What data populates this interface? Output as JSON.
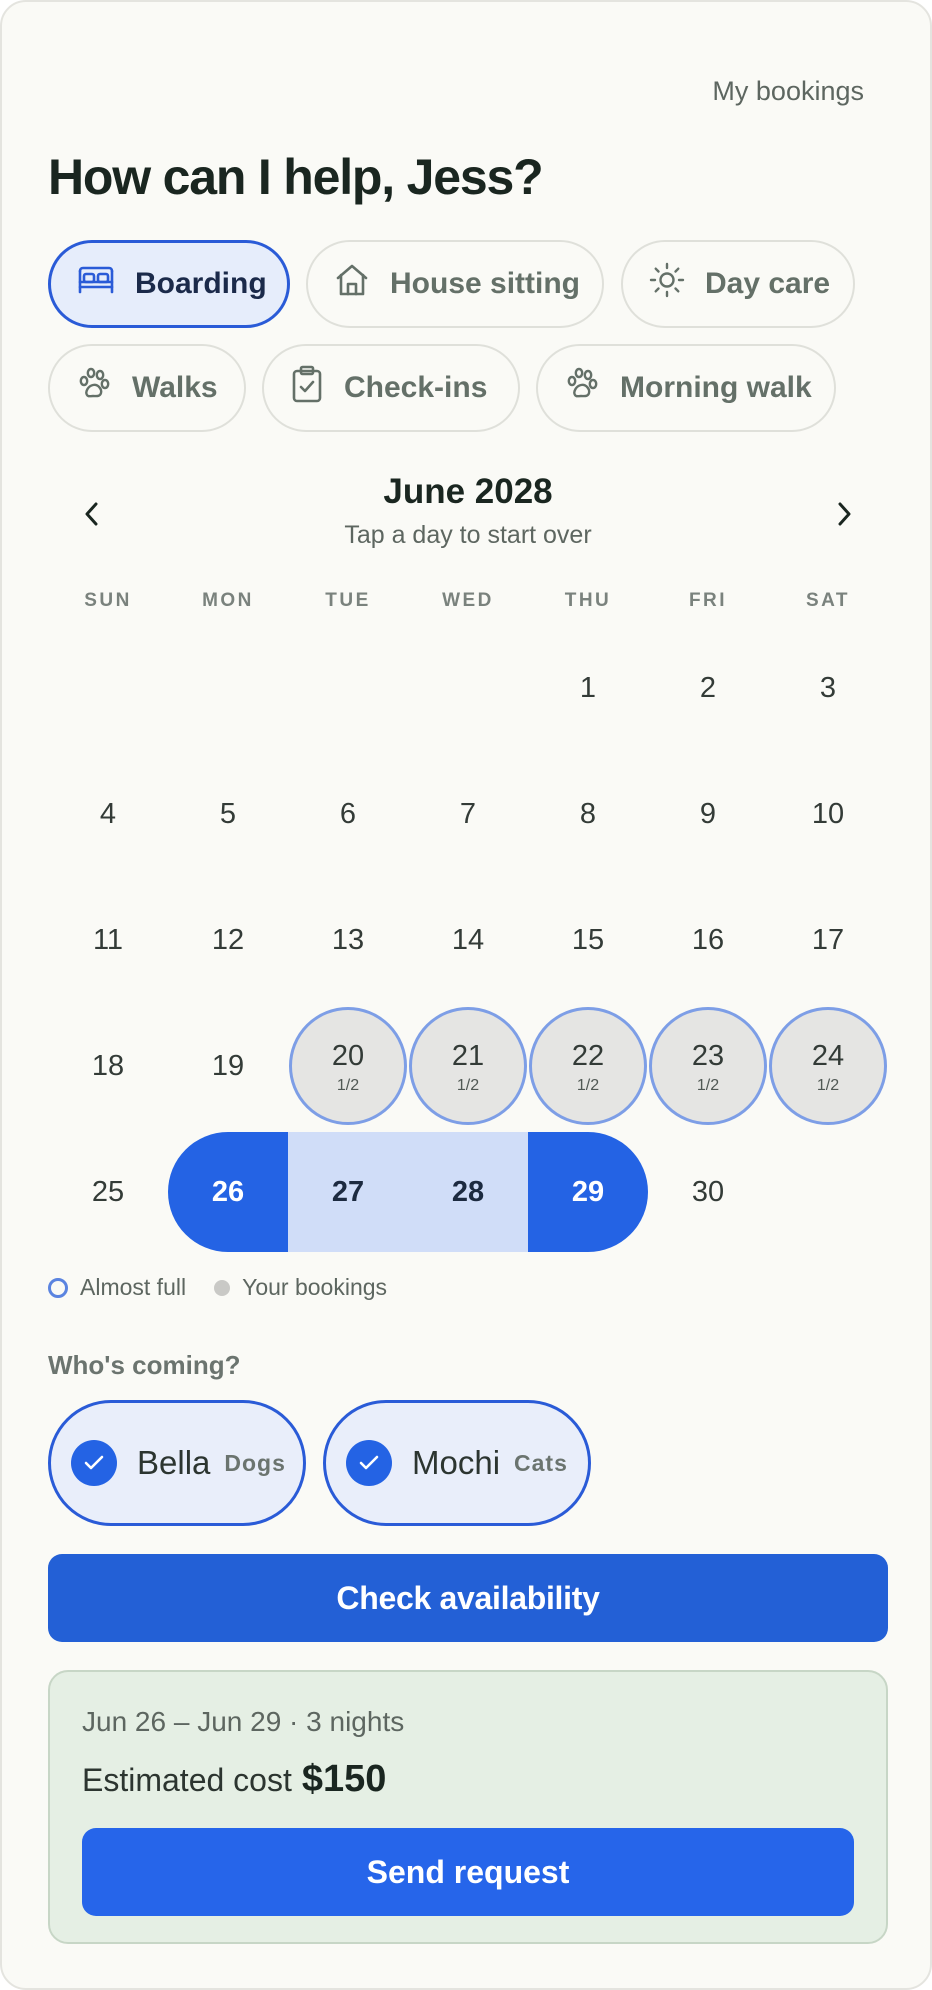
{
  "header": {
    "my_bookings": "My bookings",
    "greeting": "How can I help, Jess?"
  },
  "services": [
    {
      "label": "Boarding",
      "icon": "bed-icon",
      "active": true
    },
    {
      "label": "House sitting",
      "icon": "house-icon",
      "active": false
    },
    {
      "label": "Day care",
      "icon": "sun-icon",
      "active": false
    },
    {
      "label": "Walks",
      "icon": "paw-icon",
      "active": false
    },
    {
      "label": "Check-ins",
      "icon": "clipboard-check-icon",
      "active": false
    },
    {
      "label": "Morning walk",
      "icon": "paw-icon",
      "active": false
    }
  ],
  "calendar": {
    "month": "June 2028",
    "subtitle": "Tap a day to start over",
    "weekdays": [
      "SUN",
      "MON",
      "TUE",
      "WED",
      "THU",
      "FRI",
      "SAT"
    ],
    "first_weekday_index": 4,
    "days_in_month": 30,
    "almost_full": {
      "20": "1/2",
      "21": "1/2",
      "22": "1/2",
      "23": "1/2",
      "24": "1/2"
    },
    "selection": {
      "start": 26,
      "end": 29
    }
  },
  "legend": {
    "almost_full": "Almost full",
    "your_bookings": "Your bookings"
  },
  "pets": {
    "heading": "Who's coming?",
    "items": [
      {
        "name": "Bella",
        "type": "Dogs",
        "selected": true
      },
      {
        "name": "Mochi",
        "type": "Cats",
        "selected": true
      }
    ]
  },
  "actions": {
    "check_availability": "Check availability"
  },
  "summary": {
    "dates": "Jun 26 – Jun 29 · 3 nights",
    "cost_label": "Estimated cost",
    "cost_value": "$150",
    "send_request": "Send request"
  },
  "colors": {
    "accent": "#2463e4",
    "selected_range": "#d0ddf8",
    "almost_full_ring": "#7d9ee6",
    "summary_bg": "#e5efe4",
    "page_bg": "#fafaf6"
  }
}
